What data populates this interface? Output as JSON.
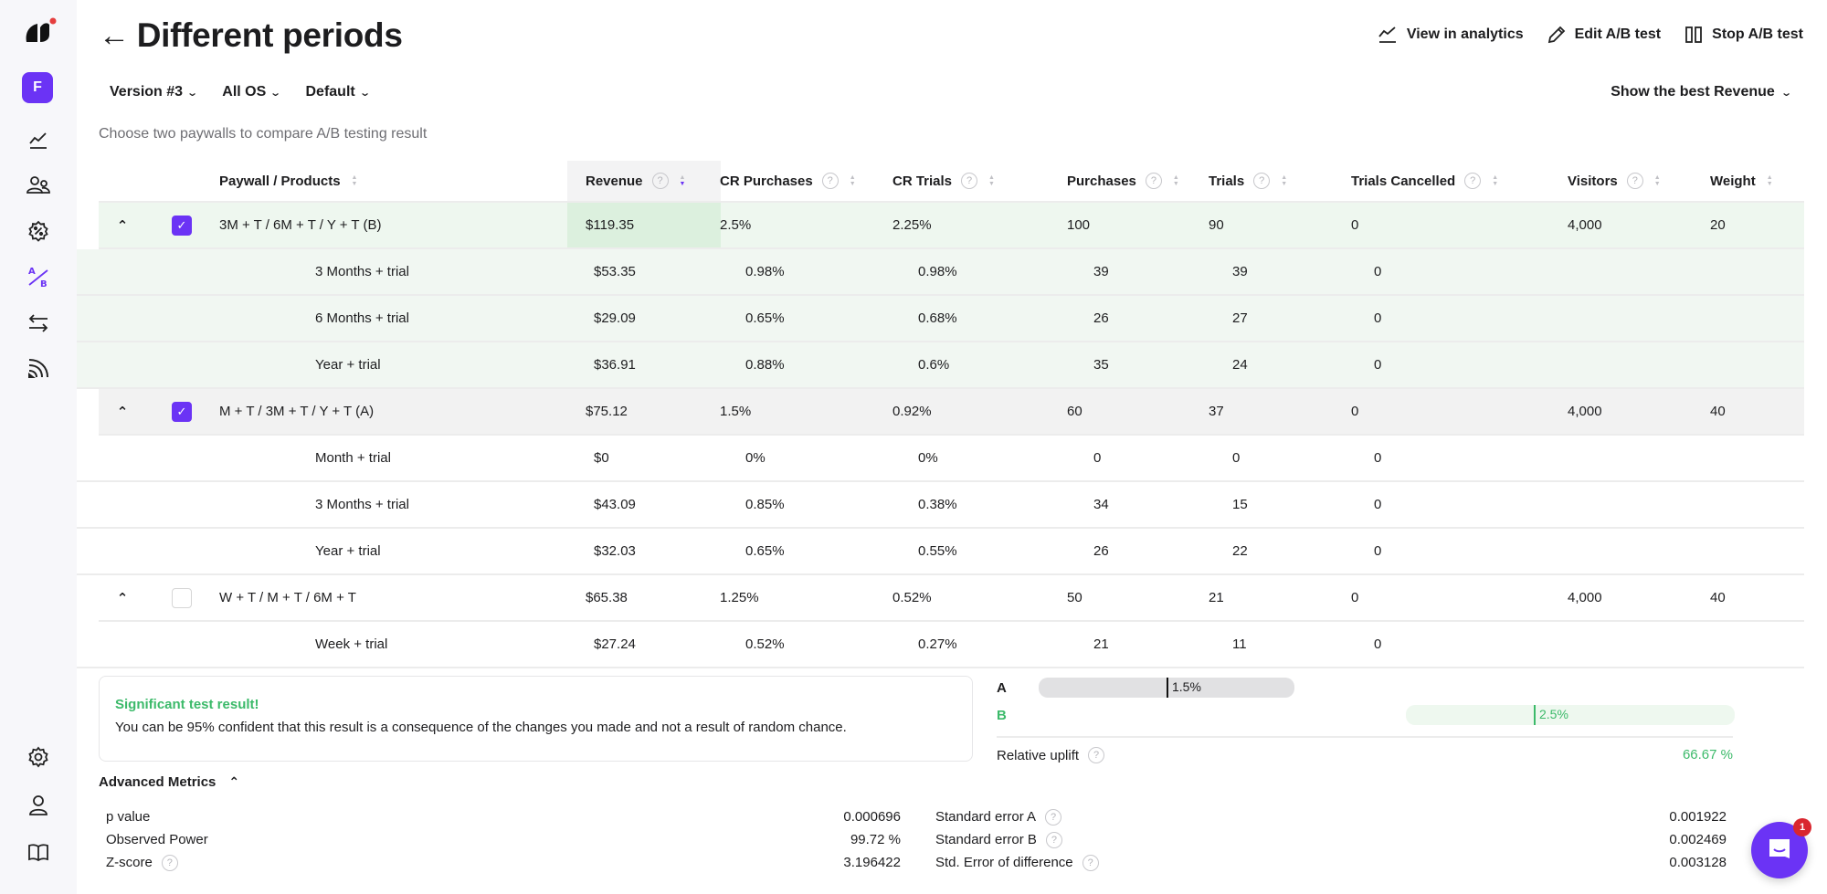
{
  "sidebar": {
    "workspace_initial": "F",
    "items": [
      {
        "name": "analytics",
        "icon": "line-chart-icon"
      },
      {
        "name": "audience",
        "icon": "users-icon"
      },
      {
        "name": "promotions",
        "icon": "discount-badge-icon"
      },
      {
        "name": "ab-tests",
        "icon": "ab-test-icon",
        "active": true
      },
      {
        "name": "integrations",
        "icon": "transfer-arrows-icon"
      },
      {
        "name": "events",
        "icon": "feed-icon"
      }
    ],
    "bottom_items": [
      {
        "name": "settings",
        "icon": "gear-icon"
      },
      {
        "name": "profile",
        "icon": "user-icon"
      },
      {
        "name": "docs",
        "icon": "book-icon"
      }
    ]
  },
  "header": {
    "back_label": "←",
    "title": "Different periods",
    "actions": [
      {
        "label": "View in analytics",
        "icon": "line-chart-icon"
      },
      {
        "label": "Edit A/B test",
        "icon": "pencil-icon"
      },
      {
        "label": "Stop A/B test",
        "icon": "pause-icon"
      }
    ],
    "filters": [
      {
        "label": "Version #3"
      },
      {
        "label": "All OS"
      },
      {
        "label": "Default"
      }
    ],
    "best_select": "Show the best Revenue",
    "subtitle": "Choose two paywalls to compare A/B testing result"
  },
  "table": {
    "columns": [
      {
        "label": "Paywall / Products",
        "help": false
      },
      {
        "label": "Revenue",
        "help": true,
        "sorted": "desc"
      },
      {
        "label": "CR Purchases",
        "help": true
      },
      {
        "label": "CR Trials",
        "help": true
      },
      {
        "label": "Purchases",
        "help": true
      },
      {
        "label": "Trials",
        "help": true
      },
      {
        "label": "Trials Cancelled",
        "help": true
      },
      {
        "label": "Visitors",
        "help": true
      },
      {
        "label": "Weight",
        "help": false
      }
    ],
    "groups": [
      {
        "name": "3M + T / 6M + T / Y + T (B)",
        "checked": true,
        "expanded": true,
        "revenue": "$119.35",
        "cr_purchases": "2.5%",
        "cr_trials": "2.25%",
        "purchases": "100",
        "trials": "90",
        "trials_cancelled": "0",
        "visitors": "4,000",
        "weight": "20",
        "products": [
          {
            "name": "3 Months + trial",
            "revenue": "$53.35",
            "cr_purchases": "0.98%",
            "cr_trials": "0.98%",
            "purchases": "39",
            "trials": "39",
            "trials_cancelled": "0"
          },
          {
            "name": "6 Months + trial",
            "revenue": "$29.09",
            "cr_purchases": "0.65%",
            "cr_trials": "0.68%",
            "purchases": "26",
            "trials": "27",
            "trials_cancelled": "0"
          },
          {
            "name": "Year + trial",
            "revenue": "$36.91",
            "cr_purchases": "0.88%",
            "cr_trials": "0.6%",
            "purchases": "35",
            "trials": "24",
            "trials_cancelled": "0"
          }
        ]
      },
      {
        "name": "M + T / 3M + T / Y + T (A)",
        "checked": true,
        "expanded": true,
        "revenue": "$75.12",
        "cr_purchases": "1.5%",
        "cr_trials": "0.92%",
        "purchases": "60",
        "trials": "37",
        "trials_cancelled": "0",
        "visitors": "4,000",
        "weight": "40",
        "products": [
          {
            "name": "Month + trial",
            "revenue": "$0",
            "cr_purchases": "0%",
            "cr_trials": "0%",
            "purchases": "0",
            "trials": "0",
            "trials_cancelled": "0"
          },
          {
            "name": "3 Months + trial",
            "revenue": "$43.09",
            "cr_purchases": "0.85%",
            "cr_trials": "0.38%",
            "purchases": "34",
            "trials": "15",
            "trials_cancelled": "0"
          },
          {
            "name": "Year + trial",
            "revenue": "$32.03",
            "cr_purchases": "0.65%",
            "cr_trials": "0.55%",
            "purchases": "26",
            "trials": "22",
            "trials_cancelled": "0"
          }
        ]
      },
      {
        "name": "W + T / M + T / 6M + T",
        "checked": false,
        "expanded": true,
        "revenue": "$65.38",
        "cr_purchases": "1.25%",
        "cr_trials": "0.52%",
        "purchases": "50",
        "trials": "21",
        "trials_cancelled": "0",
        "visitors": "4,000",
        "weight": "40",
        "products": [
          {
            "name": "Week + trial",
            "revenue": "$27.24",
            "cr_purchases": "0.52%",
            "cr_trials": "0.27%",
            "purchases": "21",
            "trials": "11",
            "trials_cancelled": "0"
          }
        ]
      }
    ]
  },
  "significance": {
    "title": "Significant test result!",
    "text": "You can be 95% confident that this result is a consequence of the changes you made and not a result of random chance."
  },
  "comparison": {
    "a_label": "A",
    "a_value": "1.5%",
    "a_rate_pct": 1.5,
    "b_label": "B",
    "b_value": "2.5%",
    "b_rate_pct": 2.5,
    "uplift_label": "Relative uplift",
    "uplift_value": "66.67 %"
  },
  "advanced": {
    "title": "Advanced Metrics",
    "left": [
      {
        "label": "p value",
        "value": "0.000696",
        "help": false
      },
      {
        "label": "Observed Power",
        "value": "99.72 %",
        "help": false
      },
      {
        "label": "Z-score",
        "value": "3.196422",
        "help": true
      }
    ],
    "right": [
      {
        "label": "Standard error A",
        "value": "0.001922",
        "help": true
      },
      {
        "label": "Standard error B",
        "value": "0.002469",
        "help": true
      },
      {
        "label": "Std. Error of difference",
        "value": "0.003128",
        "help": true
      }
    ]
  },
  "chat": {
    "badge": "1"
  },
  "colors": {
    "accent": "#6b33f5",
    "success": "#3cba6a",
    "danger": "#d9262f"
  }
}
